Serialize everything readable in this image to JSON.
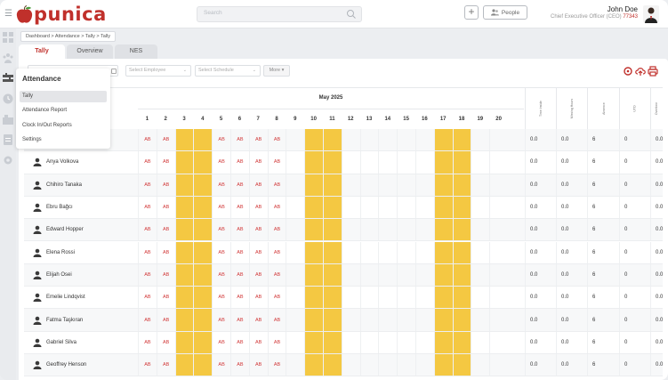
{
  "app": {
    "logo_text": "punica",
    "search_placeholder": "Search",
    "people_label": "People",
    "user_name": "John Doe",
    "user_role": "Chief Executive Officer (CEO)",
    "user_id": "77343"
  },
  "breadcrumb": "Dashboard > Attendance > Tally > Tally",
  "tabs": [
    "Tally",
    "Overview",
    "NES"
  ],
  "filters": {
    "employee_placeholder": "Select Employee",
    "schedule_placeholder": "Select Schedule",
    "more_label": "More"
  },
  "menu": {
    "title": "Attendance",
    "items": [
      "Tally",
      "Attendance Report",
      "Clock In/Out Reports",
      "Settings"
    ]
  },
  "table": {
    "month": "May 2025",
    "days": [
      "1",
      "2",
      "3",
      "4",
      "5",
      "6",
      "7",
      "8",
      "9",
      "10",
      "11",
      "12",
      "13",
      "14",
      "15",
      "16",
      "17",
      "18",
      "19",
      "20"
    ],
    "weekend_days": [
      "3",
      "4",
      "10",
      "11",
      "17",
      "18"
    ],
    "absent_days": [
      "1",
      "2",
      "5",
      "6",
      "7",
      "8"
    ],
    "absent_mark": "AB",
    "stat_headers": [
      "Time Inside",
      "Missing Hours",
      "Absence",
      "UTD",
      "Overtime"
    ],
    "rows": [
      {
        "name": "",
        "stats": [
          "0.0",
          "0.0",
          "6",
          "0",
          "0.0"
        ]
      },
      {
        "name": "Anya Volkova",
        "stats": [
          "0.0",
          "0.0",
          "6",
          "0",
          "0.0"
        ]
      },
      {
        "name": "Chihiro Tanaka",
        "stats": [
          "0.0",
          "0.0",
          "6",
          "0",
          "0.0"
        ]
      },
      {
        "name": "Ebru Bağcı",
        "stats": [
          "0.0",
          "0.0",
          "6",
          "0",
          "0.0"
        ]
      },
      {
        "name": "Edward Hopper",
        "stats": [
          "0.0",
          "0.0",
          "6",
          "0",
          "0.0"
        ]
      },
      {
        "name": "Elena Rossi",
        "stats": [
          "0.0",
          "0.0",
          "6",
          "0",
          "0.0"
        ]
      },
      {
        "name": "Elijah Osei",
        "stats": [
          "0.0",
          "0.0",
          "6",
          "0",
          "0.0"
        ]
      },
      {
        "name": "Emelie Lindqvist",
        "stats": [
          "0.0",
          "0.0",
          "6",
          "0",
          "0.0"
        ]
      },
      {
        "name": "Fatma Taşkıran",
        "stats": [
          "0.0",
          "0.0",
          "6",
          "0",
          "0.0"
        ]
      },
      {
        "name": "Gabriel Silva",
        "stats": [
          "0.0",
          "0.0",
          "6",
          "0",
          "0.0"
        ]
      },
      {
        "name": "Geoffrey Henson",
        "stats": [
          "0.0",
          "0.0",
          "6",
          "0",
          "0.0"
        ]
      }
    ]
  },
  "colors": {
    "brand": "#c0302b",
    "weekend": "#f4c842",
    "absent": "#d23a3a"
  }
}
